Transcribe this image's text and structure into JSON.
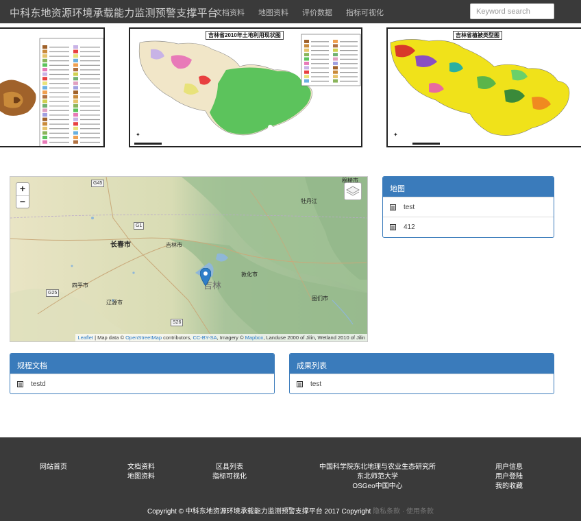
{
  "navbar": {
    "brand": "中科东地资源环境承载能力监测预警支撑平台",
    "links": [
      "文档资料",
      "地图资料",
      "评价数据",
      "指标可视化"
    ],
    "search_placeholder": "Keyword search"
  },
  "carousel": {
    "slides": [
      {
        "title": ""
      },
      {
        "title": "吉林省2010年土地利用现状图"
      },
      {
        "title": "吉林省植被类型图"
      }
    ],
    "dot_count": 2,
    "active_dot": 0
  },
  "map": {
    "zoom_in": "+",
    "zoom_out": "−",
    "cities": [
      {
        "key": "mudanjiang",
        "label": "穆棱市"
      },
      {
        "key": "mudanjiang2",
        "label": "牡丹江"
      },
      {
        "key": "changchun",
        "label": "长春市"
      },
      {
        "key": "jilin",
        "label": "吉林市"
      },
      {
        "key": "dunhua",
        "label": "敦化市"
      },
      {
        "key": "siping",
        "label": "四平市"
      },
      {
        "key": "liaoyuan",
        "label": "辽源市"
      },
      {
        "key": "tumen",
        "label": "图们市"
      }
    ],
    "province": "吉林",
    "roads": [
      "G45",
      "G1",
      "G25",
      "S26"
    ],
    "attribution": {
      "leaflet": "Leaflet",
      "text1": " | Map data © ",
      "osm": "OpenStreetMap",
      "text2": " contributors, ",
      "license": "CC-BY-SA",
      "text3": ", Imagery © ",
      "mapbox": "Mapbox",
      "text4": ", Landuse 2000 of Jilin, Wetland 2010 of Jilin"
    }
  },
  "panels": {
    "maps": {
      "title": "地图",
      "items": [
        "test",
        "412"
      ]
    },
    "docs": {
      "title": "规程文档",
      "items": [
        "testd"
      ]
    },
    "results": {
      "title": "成果列表",
      "items": [
        "test"
      ]
    }
  },
  "footer": {
    "col1": [
      "网站首页"
    ],
    "col2": [
      "文档资料",
      "地图资料"
    ],
    "col3": [
      "区县列表",
      "指标可视化"
    ],
    "col4": [
      "中国科学院东北地理与农业生态研究所",
      "东北师范大学",
      "OSGeo中国中心"
    ],
    "col5": [
      "用户信息",
      "用户登陆",
      "我的收藏"
    ],
    "copyright": "Copyright © 中科东地资源环境承载能力监测预警支撑平台 2017 Copyright",
    "privacy": "隐私条款",
    "sep": " · ",
    "terms": "使用条款"
  },
  "colors": {
    "navbar": "#3a3a3a",
    "panel_accent": "#3a7bbb",
    "footer": "#3a3a3a"
  }
}
